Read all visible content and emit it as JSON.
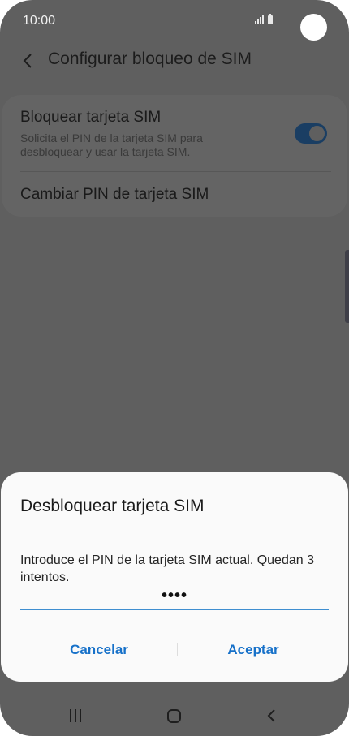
{
  "status_bar": {
    "time": "10:00"
  },
  "header": {
    "title": "Configurar bloqueo de SIM",
    "back_icon": "chevron-left-icon"
  },
  "settings": {
    "items": [
      {
        "title": "Bloquear tarjeta SIM",
        "description": "Solicita el PIN de la tarjeta SIM para desbloquear y usar la tarjeta SIM.",
        "toggle_on": true
      },
      {
        "title": "Cambiar PIN de tarjeta SIM"
      }
    ]
  },
  "dialog": {
    "title": "Desbloquear tarjeta SIM",
    "message": "Introduce el PIN de la tarjeta SIM actual. Quedan 3 intentos.",
    "pin_value": "••••",
    "cancel_label": "Cancelar",
    "accept_label": "Aceptar"
  },
  "colors": {
    "accent": "#1771c9",
    "scrim": "#5f5f5f",
    "dialog_background": "#fafafa"
  },
  "navigation": {
    "recent_icon": "recent-apps-icon",
    "home_icon": "home-icon",
    "back_icon": "back-icon"
  }
}
